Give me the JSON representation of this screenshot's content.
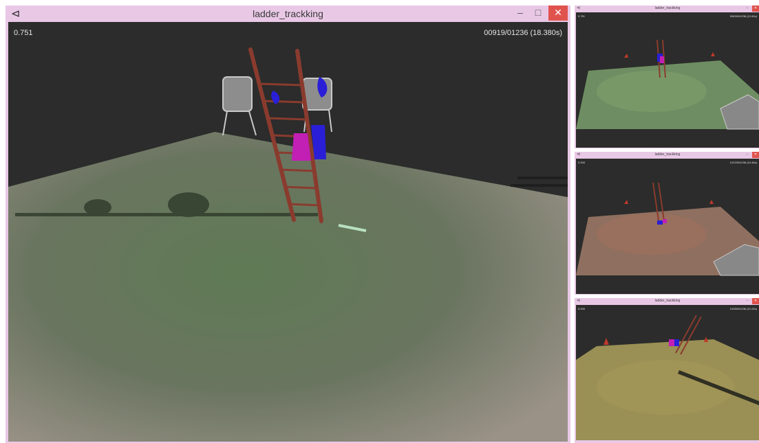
{
  "main_window": {
    "title": "ladder_trackking",
    "score": "0.751",
    "frame_counter": "00919/01236 (18.380s)",
    "buttons": {
      "minimize": "‒",
      "maximize": "□",
      "close": "✕"
    }
  },
  "side_windows": [
    {
      "title": "ladder_trackking",
      "score": "0.751",
      "frame_counter": "00630/01236 (12.60s)",
      "floor_color": "#6f8d62"
    },
    {
      "title": "ladder_trackking",
      "score": "0.000",
      "frame_counter": "01223/01236 (24.46s)",
      "floor_color": "#8f6f5f"
    },
    {
      "title": "ladder_trackking",
      "score": "0.000",
      "frame_counter": "01050/01236 (21.00s)",
      "floor_color": "#9a8f55"
    }
  ],
  "colors": {
    "window_border": "#e9c8e6",
    "close_button": "#e0534d",
    "background_3d": "#2b2b2b",
    "ladder": "#8a3b2e",
    "boot_blue": "#2a1fd6",
    "boot_magenta": "#c21fb4"
  }
}
